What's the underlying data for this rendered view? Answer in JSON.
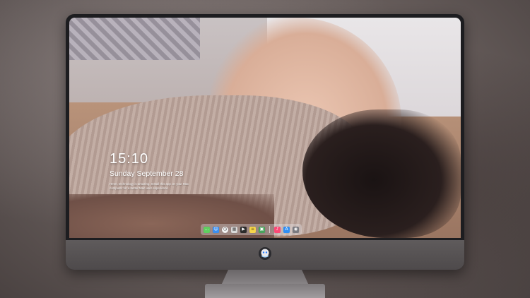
{
  "lock_screen": {
    "time": "15:10",
    "date": "Sunday September 28",
    "tagline": "Hmm, technology is amazing. Install this app on your Mac computer for a better Mac user experience"
  },
  "dock": {
    "apps": [
      {
        "name": "messages-icon",
        "color": "#5fcf5f",
        "glyph": "…"
      },
      {
        "name": "finder-icon",
        "color": "#3c8ff0",
        "glyph": "☺"
      },
      {
        "name": "clock-icon",
        "color": "#f5f5f5",
        "glyph": "◷"
      },
      {
        "name": "preview-icon",
        "color": "#d9d9d9",
        "glyph": "▦"
      },
      {
        "name": "video-editor-icon",
        "color": "#2b2b2b",
        "glyph": "▶"
      },
      {
        "name": "notes-icon",
        "color": "#f6d54a",
        "glyph": "≡"
      },
      {
        "name": "photo-app-icon",
        "color": "#4aa35c",
        "glyph": "▣"
      },
      {
        "name": "music-icon",
        "color": "#fa4a76",
        "glyph": "♪"
      },
      {
        "name": "app-store-icon",
        "color": "#2f8ef4",
        "glyph": "A"
      },
      {
        "name": "camera-icon",
        "color": "#7a7a80",
        "glyph": "◉"
      }
    ]
  },
  "colors": {
    "bezel": "#1d1d20",
    "chin": "#4e4a4b",
    "clock_text": "#ffffff"
  }
}
